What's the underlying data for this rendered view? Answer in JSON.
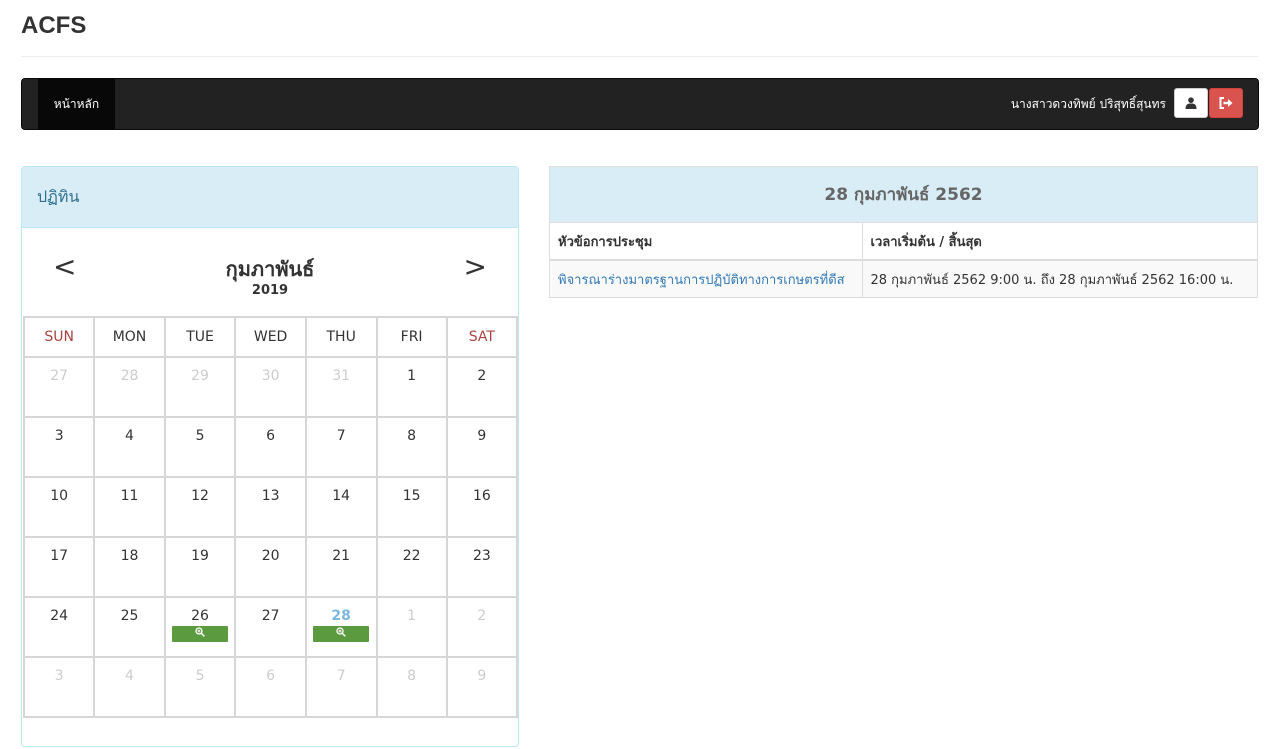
{
  "app": {
    "title": "ACFS"
  },
  "navbar": {
    "home_label": "หน้าหลัก",
    "user_name": "นางสาวดวงทิพย์ ปริสุทธิ์สุนทร",
    "profile_icon": "user-icon",
    "logout_icon": "sign-out-icon",
    "logout_color": "#d9534f"
  },
  "calendar": {
    "panel_title": "ปฏิทิน",
    "prev_label": "<",
    "next_label": ">",
    "month": "กุมภาพันธ์",
    "year": "2019",
    "weekdays": [
      "SUN",
      "MON",
      "TUE",
      "WED",
      "THU",
      "FRI",
      "SAT"
    ],
    "weeks": [
      [
        {
          "d": "27",
          "o": true
        },
        {
          "d": "28",
          "o": true
        },
        {
          "d": "29",
          "o": true
        },
        {
          "d": "30",
          "o": true
        },
        {
          "d": "31",
          "o": true
        },
        {
          "d": "1"
        },
        {
          "d": "2"
        }
      ],
      [
        {
          "d": "3"
        },
        {
          "d": "4"
        },
        {
          "d": "5"
        },
        {
          "d": "6"
        },
        {
          "d": "7"
        },
        {
          "d": "8"
        },
        {
          "d": "9"
        }
      ],
      [
        {
          "d": "10"
        },
        {
          "d": "11"
        },
        {
          "d": "12"
        },
        {
          "d": "13"
        },
        {
          "d": "14"
        },
        {
          "d": "15"
        },
        {
          "d": "16"
        }
      ],
      [
        {
          "d": "17"
        },
        {
          "d": "18"
        },
        {
          "d": "19"
        },
        {
          "d": "20"
        },
        {
          "d": "21"
        },
        {
          "d": "22"
        },
        {
          "d": "23"
        }
      ],
      [
        {
          "d": "24"
        },
        {
          "d": "25"
        },
        {
          "d": "26",
          "event": true
        },
        {
          "d": "27"
        },
        {
          "d": "28",
          "event": true,
          "today": true
        },
        {
          "d": "1",
          "o": true
        },
        {
          "d": "2",
          "o": true
        }
      ],
      [
        {
          "d": "3",
          "o": true
        },
        {
          "d": "4",
          "o": true
        },
        {
          "d": "5",
          "o": true
        },
        {
          "d": "6",
          "o": true
        },
        {
          "d": "7",
          "o": true
        },
        {
          "d": "8",
          "o": true
        },
        {
          "d": "9",
          "o": true
        }
      ]
    ],
    "event_icon": "zoom-in-icon",
    "event_color": "#5b9a3e",
    "weekend_color": "#a94442",
    "today_color": "#7cb8e0"
  },
  "detail": {
    "heading": "28 กุมภาพันธ์ 2562",
    "columns": [
      "หัวข้อการประชุม",
      "เวลาเริ่มต้น / สิ้นสุด"
    ],
    "rows": [
      {
        "topic": "พิจารณาร่างมาตรฐานการปฏิบัติทางการเกษตรที่ดีส",
        "time": "28 กุมภาพันธ์ 2562 9:00 น. ถึง 28 กุมภาพันธ์ 2562 16:00 น."
      }
    ]
  }
}
